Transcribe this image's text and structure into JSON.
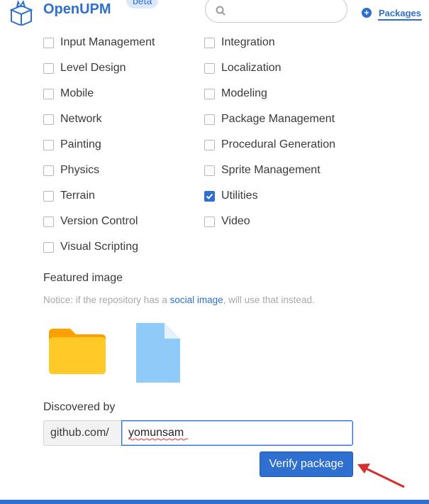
{
  "header": {
    "brand": "OpenUPM",
    "beta_badge": "beta",
    "search_placeholder": "",
    "nav_packages": "Packages"
  },
  "categories": {
    "left": [
      {
        "label": "Input Management",
        "checked": false
      },
      {
        "label": "Level Design",
        "checked": false
      },
      {
        "label": "Mobile",
        "checked": false
      },
      {
        "label": "Network",
        "checked": false
      },
      {
        "label": "Painting",
        "checked": false
      },
      {
        "label": "Physics",
        "checked": false
      },
      {
        "label": "Terrain",
        "checked": false
      },
      {
        "label": "Version Control",
        "checked": false
      },
      {
        "label": "Visual Scripting",
        "checked": false
      }
    ],
    "right": [
      {
        "label": "Integration",
        "checked": false
      },
      {
        "label": "Localization",
        "checked": false
      },
      {
        "label": "Modeling",
        "checked": false
      },
      {
        "label": "Package Management",
        "checked": false
      },
      {
        "label": "Procedural Generation",
        "checked": false
      },
      {
        "label": "Sprite Management",
        "checked": false
      },
      {
        "label": "Utilities",
        "checked": true
      },
      {
        "label": "Video",
        "checked": false
      }
    ]
  },
  "featured": {
    "title": "Featured image",
    "notice_before": "Notice: if the repository has a ",
    "notice_link": "social image",
    "notice_after": ", will use that instead."
  },
  "discovered": {
    "title": "Discovered by",
    "prefix": "github.com/",
    "value": "yomunsam"
  },
  "verify_button": "Verify package",
  "colors": {
    "accent": "#2e6fcf",
    "folder": "#ffc525",
    "file": "#90caf9",
    "arrow": "#d32f2f"
  }
}
